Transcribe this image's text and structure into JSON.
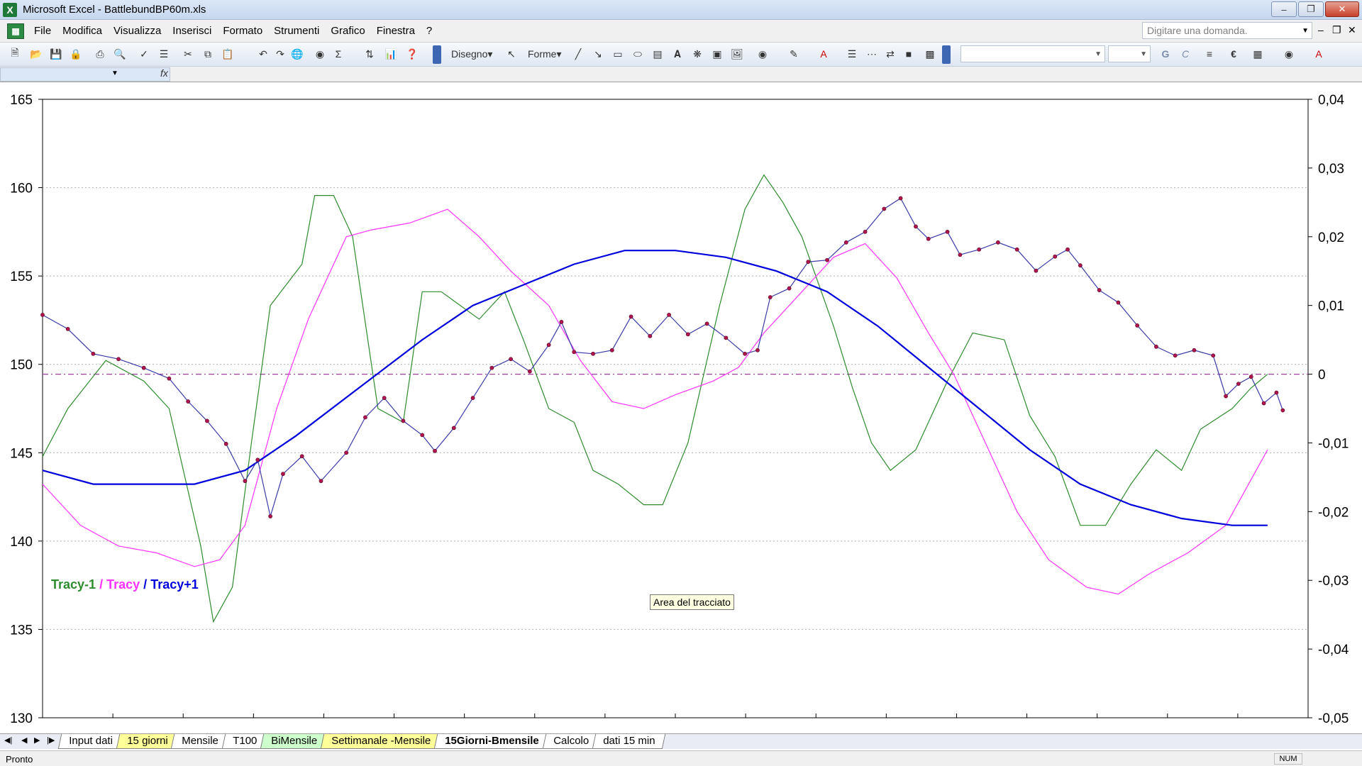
{
  "window": {
    "title": "Microsoft Excel - BattlebundBP60m.xls",
    "app_icon": "excel-icon",
    "controls": [
      "minimize",
      "restore",
      "close"
    ]
  },
  "menu": {
    "items": [
      "File",
      "Modifica",
      "Visualizza",
      "Inserisci",
      "Formato",
      "Strumenti",
      "Grafico",
      "Finestra",
      "?"
    ],
    "ask_placeholder": "Digitare una domanda."
  },
  "toolbar": {
    "draw_label": "Disegno",
    "shapes_label": "Forme",
    "bold_label": "G",
    "italic_label": "C",
    "euro_label": "€"
  },
  "chart": {
    "legend": {
      "sep": "/",
      "tracy_m1": "Tracy-1",
      "tracy": "Tracy",
      "tracy_p1": "Tracy+1"
    },
    "tooltip": "Area del tracciato",
    "colors": {
      "price": "#3a3aa8",
      "marker": "#b0144c",
      "tracy_m1": "#2e8b2e",
      "tracy": "#ff33ff",
      "tracy_p1": "#0000dd",
      "zero_line": "#a040a0"
    }
  },
  "chart_data": {
    "type": "line",
    "y_left": {
      "min": 130,
      "max": 165,
      "ticks": [
        "165",
        "160",
        "155",
        "150",
        "145",
        "140",
        "135",
        "130"
      ]
    },
    "y_right": {
      "min": -0.05,
      "max": 0.04,
      "ticks": [
        "0,04",
        "0,03",
        "0,02",
        "0,01",
        "0",
        "-0,01",
        "-0,02",
        "-0,03",
        "-0,04",
        "-0,05"
      ]
    },
    "x_count": 1000,
    "grid": true,
    "series": [
      {
        "name": "Price",
        "axis": "left",
        "points": [
          [
            0,
            152.8
          ],
          [
            20,
            152
          ],
          [
            40,
            150.6
          ],
          [
            60,
            150.3
          ],
          [
            80,
            149.8
          ],
          [
            100,
            149.2
          ],
          [
            115,
            147.9
          ],
          [
            130,
            146.8
          ],
          [
            145,
            145.5
          ],
          [
            160,
            143.4
          ],
          [
            170,
            144.6
          ],
          [
            180,
            141.4
          ],
          [
            190,
            143.8
          ],
          [
            205,
            144.8
          ],
          [
            220,
            143.4
          ],
          [
            240,
            145
          ],
          [
            255,
            147
          ],
          [
            270,
            148.1
          ],
          [
            285,
            146.8
          ],
          [
            300,
            146
          ],
          [
            310,
            145.1
          ],
          [
            325,
            146.4
          ],
          [
            340,
            148.1
          ],
          [
            355,
            149.8
          ],
          [
            370,
            150.3
          ],
          [
            385,
            149.6
          ],
          [
            400,
            151.1
          ],
          [
            410,
            152.4
          ],
          [
            420,
            150.7
          ],
          [
            435,
            150.6
          ],
          [
            450,
            150.8
          ],
          [
            465,
            152.7
          ],
          [
            480,
            151.6
          ],
          [
            495,
            152.8
          ],
          [
            510,
            151.7
          ],
          [
            525,
            152.3
          ],
          [
            540,
            151.5
          ],
          [
            555,
            150.6
          ],
          [
            565,
            150.8
          ],
          [
            575,
            153.8
          ],
          [
            590,
            154.3
          ],
          [
            605,
            155.8
          ],
          [
            620,
            155.9
          ],
          [
            635,
            156.9
          ],
          [
            650,
            157.5
          ],
          [
            665,
            158.8
          ],
          [
            678,
            159.4
          ],
          [
            690,
            157.8
          ],
          [
            700,
            157.1
          ],
          [
            715,
            157.5
          ],
          [
            725,
            156.2
          ],
          [
            740,
            156.5
          ],
          [
            755,
            156.9
          ],
          [
            770,
            156.5
          ],
          [
            785,
            155.3
          ],
          [
            800,
            156.1
          ],
          [
            810,
            156.5
          ],
          [
            820,
            155.6
          ],
          [
            835,
            154.2
          ],
          [
            850,
            153.5
          ],
          [
            865,
            152.2
          ],
          [
            880,
            151
          ],
          [
            895,
            150.5
          ],
          [
            910,
            150.8
          ],
          [
            925,
            150.5
          ],
          [
            935,
            148.2
          ],
          [
            945,
            148.9
          ],
          [
            955,
            149.3
          ],
          [
            965,
            147.8
          ],
          [
            975,
            148.4
          ],
          [
            980,
            147.4
          ]
        ]
      },
      {
        "name": "Tracy-1",
        "axis": "right",
        "points": [
          [
            0,
            -0.012
          ],
          [
            20,
            -0.005
          ],
          [
            50,
            0.002
          ],
          [
            80,
            -0.001
          ],
          [
            100,
            -0.005
          ],
          [
            125,
            -0.025
          ],
          [
            135,
            -0.036
          ],
          [
            150,
            -0.031
          ],
          [
            165,
            -0.01
          ],
          [
            180,
            0.01
          ],
          [
            205,
            0.016
          ],
          [
            215,
            0.026
          ],
          [
            230,
            0.026
          ],
          [
            245,
            0.02
          ],
          [
            265,
            -0.005
          ],
          [
            285,
            -0.007
          ],
          [
            300,
            0.012
          ],
          [
            315,
            0.012
          ],
          [
            345,
            0.008
          ],
          [
            365,
            0.012
          ],
          [
            380,
            0.005
          ],
          [
            400,
            -0.005
          ],
          [
            420,
            -0.007
          ],
          [
            435,
            -0.014
          ],
          [
            455,
            -0.016
          ],
          [
            475,
            -0.019
          ],
          [
            490,
            -0.019
          ],
          [
            510,
            -0.01
          ],
          [
            535,
            0.01
          ],
          [
            555,
            0.024
          ],
          [
            570,
            0.029
          ],
          [
            585,
            0.025
          ],
          [
            600,
            0.02
          ],
          [
            625,
            0.007
          ],
          [
            640,
            -0.002
          ],
          [
            655,
            -0.01
          ],
          [
            670,
            -0.014
          ],
          [
            690,
            -0.011
          ],
          [
            715,
            -0.001
          ],
          [
            735,
            0.006
          ],
          [
            760,
            0.005
          ],
          [
            780,
            -0.006
          ],
          [
            800,
            -0.012
          ],
          [
            820,
            -0.022
          ],
          [
            840,
            -0.022
          ],
          [
            860,
            -0.016
          ],
          [
            880,
            -0.011
          ],
          [
            900,
            -0.014
          ],
          [
            915,
            -0.008
          ],
          [
            940,
            -0.005
          ],
          [
            955,
            -0.002
          ],
          [
            968,
            0
          ]
        ]
      },
      {
        "name": "Tracy",
        "axis": "right",
        "points": [
          [
            0,
            -0.016
          ],
          [
            30,
            -0.022
          ],
          [
            60,
            -0.025
          ],
          [
            90,
            -0.026
          ],
          [
            120,
            -0.028
          ],
          [
            140,
            -0.027
          ],
          [
            160,
            -0.022
          ],
          [
            185,
            -0.005
          ],
          [
            210,
            0.008
          ],
          [
            240,
            0.02
          ],
          [
            260,
            0.021
          ],
          [
            290,
            0.022
          ],
          [
            320,
            0.024
          ],
          [
            345,
            0.02
          ],
          [
            370,
            0.015
          ],
          [
            400,
            0.01
          ],
          [
            425,
            0.002
          ],
          [
            450,
            -0.004
          ],
          [
            475,
            -0.005
          ],
          [
            500,
            -0.003
          ],
          [
            530,
            -0.001
          ],
          [
            550,
            0.001
          ],
          [
            570,
            0.006
          ],
          [
            600,
            0.012
          ],
          [
            625,
            0.017
          ],
          [
            650,
            0.019
          ],
          [
            675,
            0.014
          ],
          [
            700,
            0.006
          ],
          [
            720,
            0
          ],
          [
            745,
            -0.01
          ],
          [
            770,
            -0.02
          ],
          [
            795,
            -0.027
          ],
          [
            825,
            -0.031
          ],
          [
            850,
            -0.032
          ],
          [
            875,
            -0.029
          ],
          [
            905,
            -0.026
          ],
          [
            935,
            -0.022
          ],
          [
            968,
            -0.011
          ]
        ]
      },
      {
        "name": "Tracy+1",
        "axis": "right",
        "points": [
          [
            0,
            -0.014
          ],
          [
            40,
            -0.016
          ],
          [
            80,
            -0.016
          ],
          [
            120,
            -0.016
          ],
          [
            160,
            -0.014
          ],
          [
            200,
            -0.009
          ],
          [
            250,
            -0.002
          ],
          [
            300,
            0.005
          ],
          [
            340,
            0.01
          ],
          [
            380,
            0.013
          ],
          [
            420,
            0.016
          ],
          [
            460,
            0.018
          ],
          [
            500,
            0.018
          ],
          [
            540,
            0.017
          ],
          [
            580,
            0.015
          ],
          [
            620,
            0.012
          ],
          [
            660,
            0.007
          ],
          [
            700,
            0.001
          ],
          [
            740,
            -0.005
          ],
          [
            780,
            -0.011
          ],
          [
            820,
            -0.016
          ],
          [
            860,
            -0.019
          ],
          [
            900,
            -0.021
          ],
          [
            940,
            -0.022
          ],
          [
            968,
            -0.022
          ]
        ]
      },
      {
        "name": "zero",
        "axis": "right",
        "points": [
          [
            0,
            0
          ],
          [
            1000,
            0
          ]
        ]
      }
    ]
  },
  "sheets": {
    "tabs": [
      {
        "label": "Input dati",
        "style": "white"
      },
      {
        "label": "15 giorni",
        "style": "yellow"
      },
      {
        "label": "Mensile",
        "style": "white"
      },
      {
        "label": "T100",
        "style": "white"
      },
      {
        "label": "BiMensile",
        "style": "green"
      },
      {
        "label": "Settimanale -Mensile",
        "style": "yellow"
      },
      {
        "label": "15Giorni-Bmensile",
        "style": "active"
      },
      {
        "label": "Calcolo",
        "style": "white"
      },
      {
        "label": "dati 15 min",
        "style": "white"
      }
    ]
  },
  "status": {
    "text": "Pronto",
    "num": "NUM"
  }
}
